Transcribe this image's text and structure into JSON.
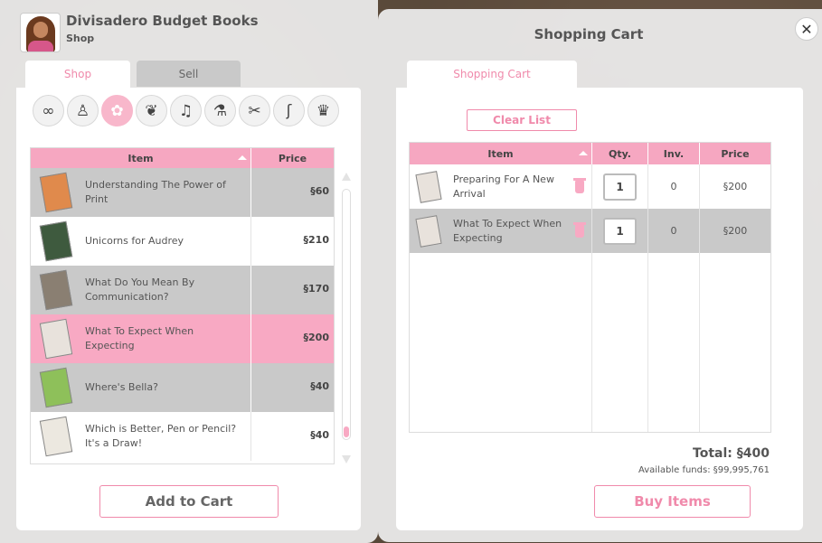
{
  "shop": {
    "title": "Divisadero Budget Books",
    "subtitle": "Shop",
    "tabs": {
      "shop": "Shop",
      "sell": "Sell"
    },
    "categories": [
      {
        "icon": "infinity-icon",
        "glyph": "∞"
      },
      {
        "icon": "clothing-icon",
        "glyph": "♙"
      },
      {
        "icon": "flowers-icon",
        "glyph": "✿"
      },
      {
        "icon": "gardening-icon",
        "glyph": "❦"
      },
      {
        "icon": "music-icon",
        "glyph": "♫"
      },
      {
        "icon": "potion-icon",
        "glyph": "⚗"
      },
      {
        "icon": "tools-icon",
        "glyph": "✂"
      },
      {
        "icon": "fishing-icon",
        "glyph": "ʃ"
      },
      {
        "icon": "chef-hat-icon",
        "glyph": "♛"
      }
    ],
    "table": {
      "col_item": "Item",
      "col_price": "Price",
      "rows": [
        {
          "name": "Understanding The Power of Print",
          "price": "§60"
        },
        {
          "name": "Unicorns for Audrey",
          "price": "§210"
        },
        {
          "name": "What Do You Mean By Communication?",
          "price": "§170"
        },
        {
          "name": "What To Expect When Expecting",
          "price": "§200"
        },
        {
          "name": "Where's Bella?",
          "price": "§40"
        },
        {
          "name": "Which is Better, Pen or Pencil? It's a Draw!",
          "price": "§40"
        }
      ]
    },
    "add_button": "Add to Cart"
  },
  "cart": {
    "title": "Shopping Cart",
    "tab": "Shopping Cart",
    "clear_button": "Clear List",
    "columns": {
      "item": "Item",
      "qty": "Qty.",
      "inv": "Inv.",
      "price": "Price"
    },
    "rows": [
      {
        "name": "Preparing For A New Arrival",
        "qty": "1",
        "inv": "0",
        "price": "§200"
      },
      {
        "name": "What To Expect When Expecting",
        "qty": "1",
        "inv": "0",
        "price": "§200"
      }
    ],
    "total": "Total: §400",
    "funds": "Available funds: §99,995,761",
    "buy_button": "Buy Items"
  },
  "colors": {
    "accent_pink": "#f08aab",
    "header_pink": "#f6a7c1",
    "selected_row": "#f8a9c3"
  }
}
